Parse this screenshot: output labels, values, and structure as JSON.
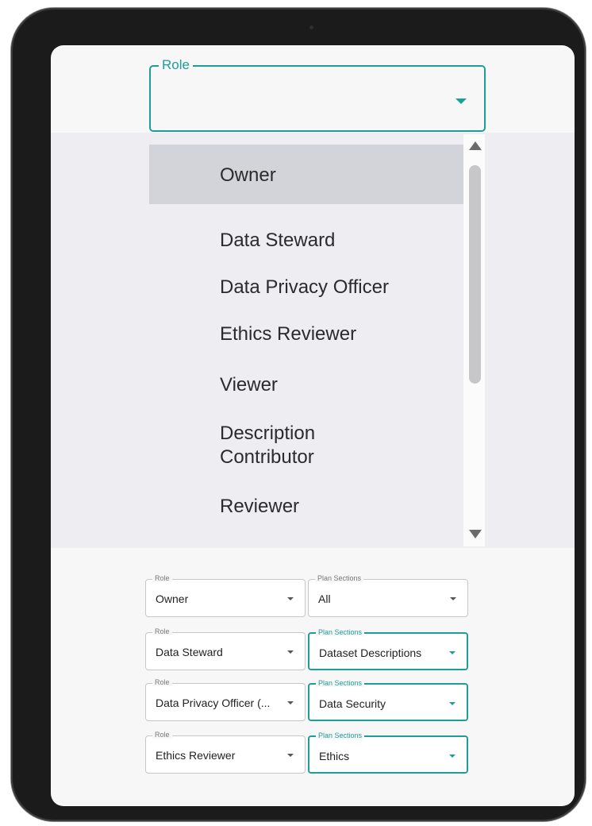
{
  "role_select": {
    "label": "Role",
    "value": ""
  },
  "menu": {
    "items": [
      {
        "label": "Owner",
        "selected": true
      },
      {
        "label": "Data Steward"
      },
      {
        "label": "Data Privacy Officer"
      },
      {
        "label": "Ethics Reviewer"
      },
      {
        "label": "Viewer"
      },
      {
        "label": "Description Contributor"
      },
      {
        "label": "Reviewer"
      }
    ]
  },
  "assignments": [
    {
      "role_label": "Role",
      "role": "Owner",
      "sections_label": "Plan Sections",
      "sections": "All"
    },
    {
      "role_label": "Role",
      "role": "Data Steward",
      "sections_label": "Plan Sections",
      "sections": "Dataset Descriptions"
    },
    {
      "role_label": "Role",
      "role": "Data Privacy Officer (...",
      "sections_label": "Plan Sections",
      "sections": "Data Security"
    },
    {
      "role_label": "Role",
      "role": "Ethics Reviewer",
      "sections_label": "Plan Sections",
      "sections": "Ethics"
    }
  ],
  "colors": {
    "accent": "#1f9e97",
    "menu_background": "#ededf2",
    "selected_item": "#d3d3da"
  }
}
